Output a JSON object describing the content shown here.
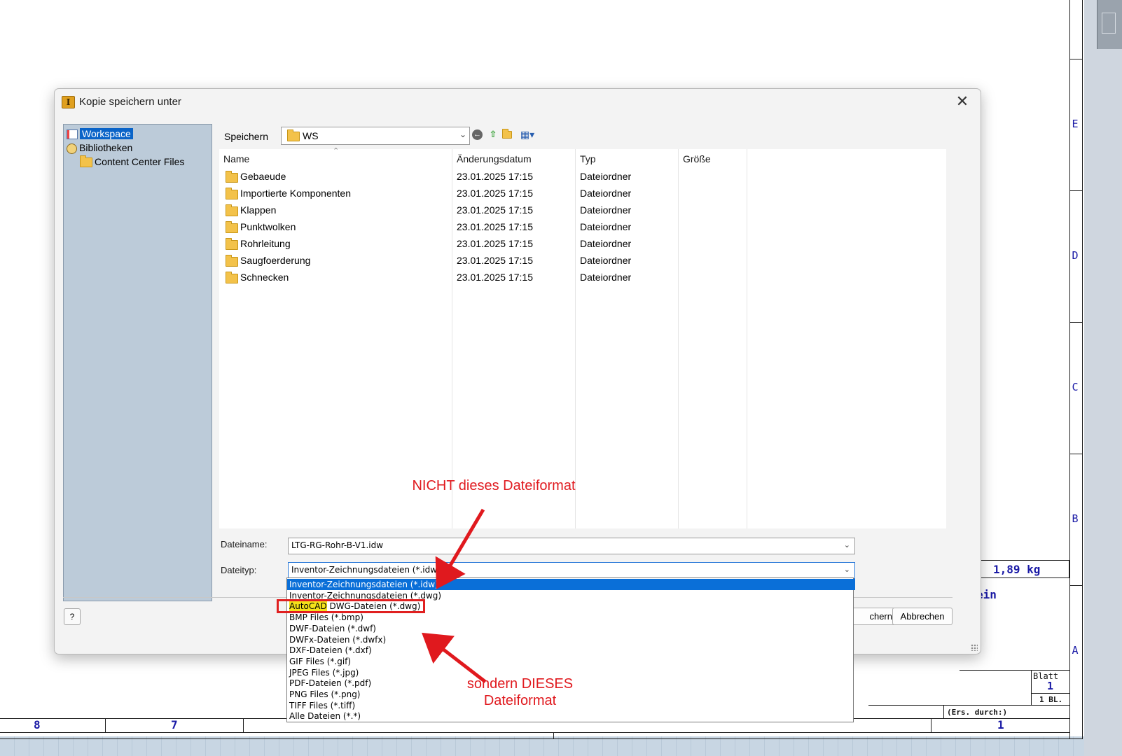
{
  "dialog": {
    "title": "Kopie speichern unter",
    "close_label": "✕",
    "tree": [
      {
        "label": "Workspace"
      },
      {
        "label": "Bibliotheken"
      },
      {
        "label": "Content Center Files"
      }
    ],
    "save_in_label": "Speichern",
    "save_in_value": "WS",
    "columns": {
      "name": "Name",
      "date": "Änderungsdatum",
      "type": "Typ",
      "size": "Größe"
    },
    "files": [
      {
        "name": "Gebaeude",
        "date": "23.01.2025 17:15",
        "type": "Dateiordner"
      },
      {
        "name": "Importierte Komponenten",
        "date": "23.01.2025 17:15",
        "type": "Dateiordner"
      },
      {
        "name": "Klappen",
        "date": "23.01.2025 17:15",
        "type": "Dateiordner"
      },
      {
        "name": "Punktwolken",
        "date": "23.01.2025 17:15",
        "type": "Dateiordner"
      },
      {
        "name": "Rohrleitung",
        "date": "23.01.2025 17:15",
        "type": "Dateiordner"
      },
      {
        "name": "Saugfoerderung",
        "date": "23.01.2025 17:15",
        "type": "Dateiordner"
      },
      {
        "name": "Schnecken",
        "date": "23.01.2025 17:15",
        "type": "Dateiordner"
      }
    ],
    "filename_label": "Dateiname:",
    "filename_value": "LTG-RG-Rohr-B-V1.idw",
    "filetype_label": "Dateityp:",
    "filetype_value": "Inventor-Zeichnungsdateien (*.idw)",
    "filetype_options": [
      "Inventor-Zeichnungsdateien (*.idw)",
      "Inventor-Zeichnungsdateien (*.dwg)",
      "AutoCAD DWG-Dateien (*.dwg)",
      "BMP Files (*.bmp)",
      "DWF-Dateien (*.dwf)",
      "DWFx-Dateien (*.dwfx)",
      "DXF-Dateien (*.dxf)",
      "GIF Files (*.gif)",
      "JPEG Files (*.jpg)",
      "PDF-Dateien (*.pdf)",
      "PNG Files (*.png)",
      "TIFF Files (*.tiff)",
      "Alle Dateien (*.*)"
    ],
    "selected_option_index": 0,
    "highlighted_option_index": 2,
    "highlight_word": "AutoCAD",
    "highlight_rest": " DWG-Dateien (*.dwg)",
    "save_button_partial": "chern",
    "cancel_button": "Abbrechen",
    "help_icon": "help-icon"
  },
  "annotations": {
    "not_this": "NICHT dieses Dateiformat",
    "but_this_line1": "sondern DIESES",
    "but_this_line2": "Dateiformat",
    "color": "#e0191e"
  },
  "drawing": {
    "zones": [
      "E",
      "D",
      "C",
      "B",
      "A"
    ],
    "bottom_numbers": [
      "8",
      "7",
      "1"
    ],
    "mass": "1,89 kg",
    "partial_text": "ein",
    "blatt_label": "Blatt",
    "blatt_value": "1",
    "sheets": "1  BL.",
    "replaced_by": "(Ers. durch:)",
    "line_color": "#1a1aa6"
  }
}
